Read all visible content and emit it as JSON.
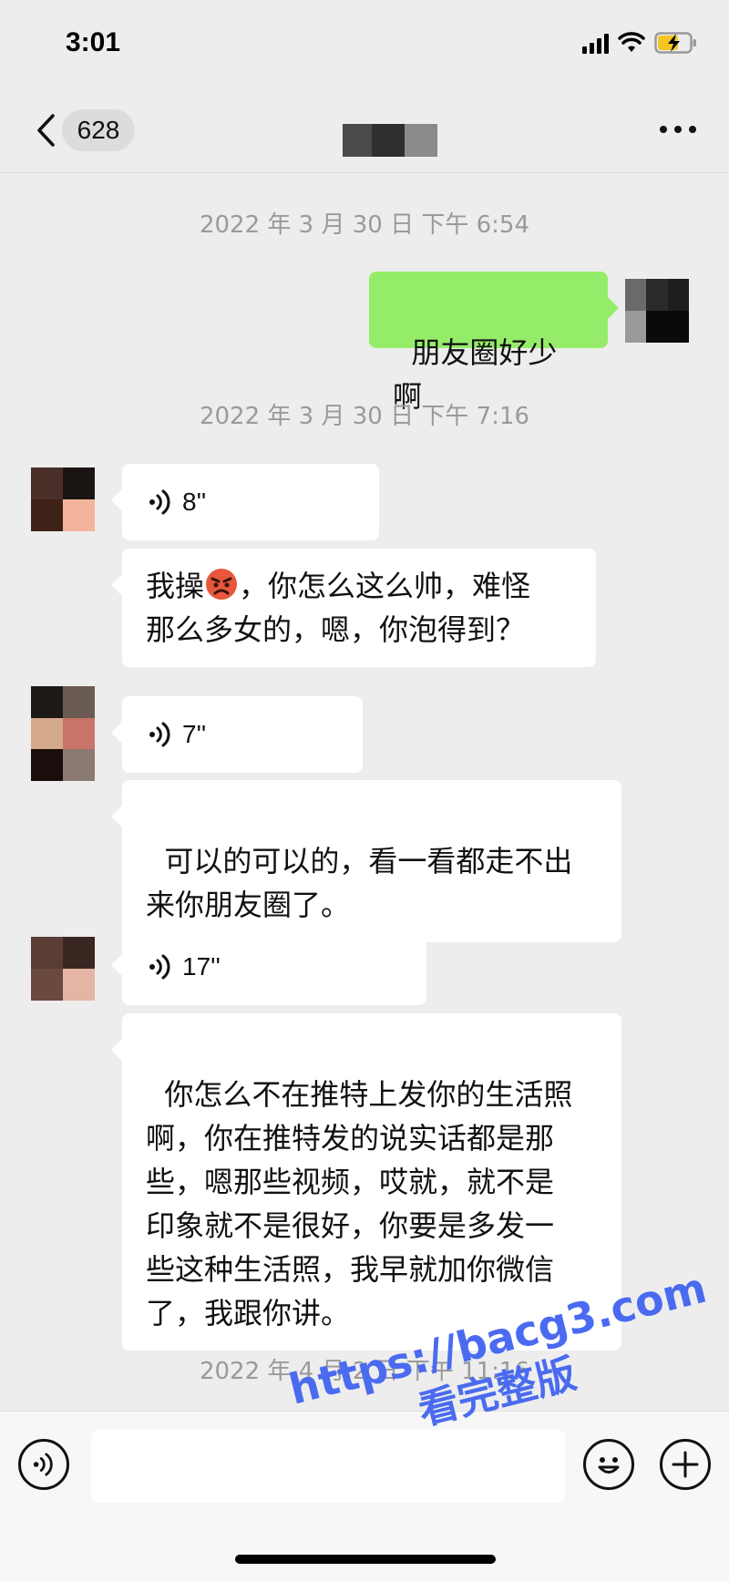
{
  "status_bar": {
    "time": "3:01"
  },
  "nav": {
    "unread_count": "628"
  },
  "messages": [
    {
      "type": "timestamp",
      "text": "2022 年 3 月 30 日 下午 6:54"
    },
    {
      "type": "text",
      "side": "right",
      "text": "朋友圈好少啊"
    },
    {
      "type": "timestamp",
      "text": "2022 年 3 月 30 日 下午 7:16"
    },
    {
      "type": "voice",
      "side": "left",
      "duration": "8''"
    },
    {
      "type": "text",
      "side": "left",
      "text_before_emoji": "我操",
      "emoji": "angry-face",
      "text_after_emoji": "，你怎么这么帅，难怪\n那么多女的，嗯，你泡得到？"
    },
    {
      "type": "voice",
      "side": "left",
      "duration": "7''"
    },
    {
      "type": "text",
      "side": "left",
      "text": "可以的可以的，看一看都走不出\n来你朋友圈了。"
    },
    {
      "type": "voice",
      "side": "left",
      "duration": "17''"
    },
    {
      "type": "text",
      "side": "left",
      "text": "你怎么不在推特上发你的生活照\n啊，你在推特发的说实话都是那\n些，嗯那些视频，哎就，就不是\n印象就不是很好，你要是多发一\n些这种生活照，我早就加你微信\n了，我跟你讲。"
    },
    {
      "type": "timestamp",
      "text": "2022 年 4 月 2 日 下午 11:16"
    }
  ],
  "input_bar": {
    "value": ""
  },
  "watermark": {
    "url": "https://bacg3.com",
    "text": "看完整版"
  },
  "colors": {
    "outgoing_bubble": "#95ec69",
    "incoming_bubble": "#ffffff",
    "background": "#ededed",
    "watermark": "#4a6bf0"
  }
}
